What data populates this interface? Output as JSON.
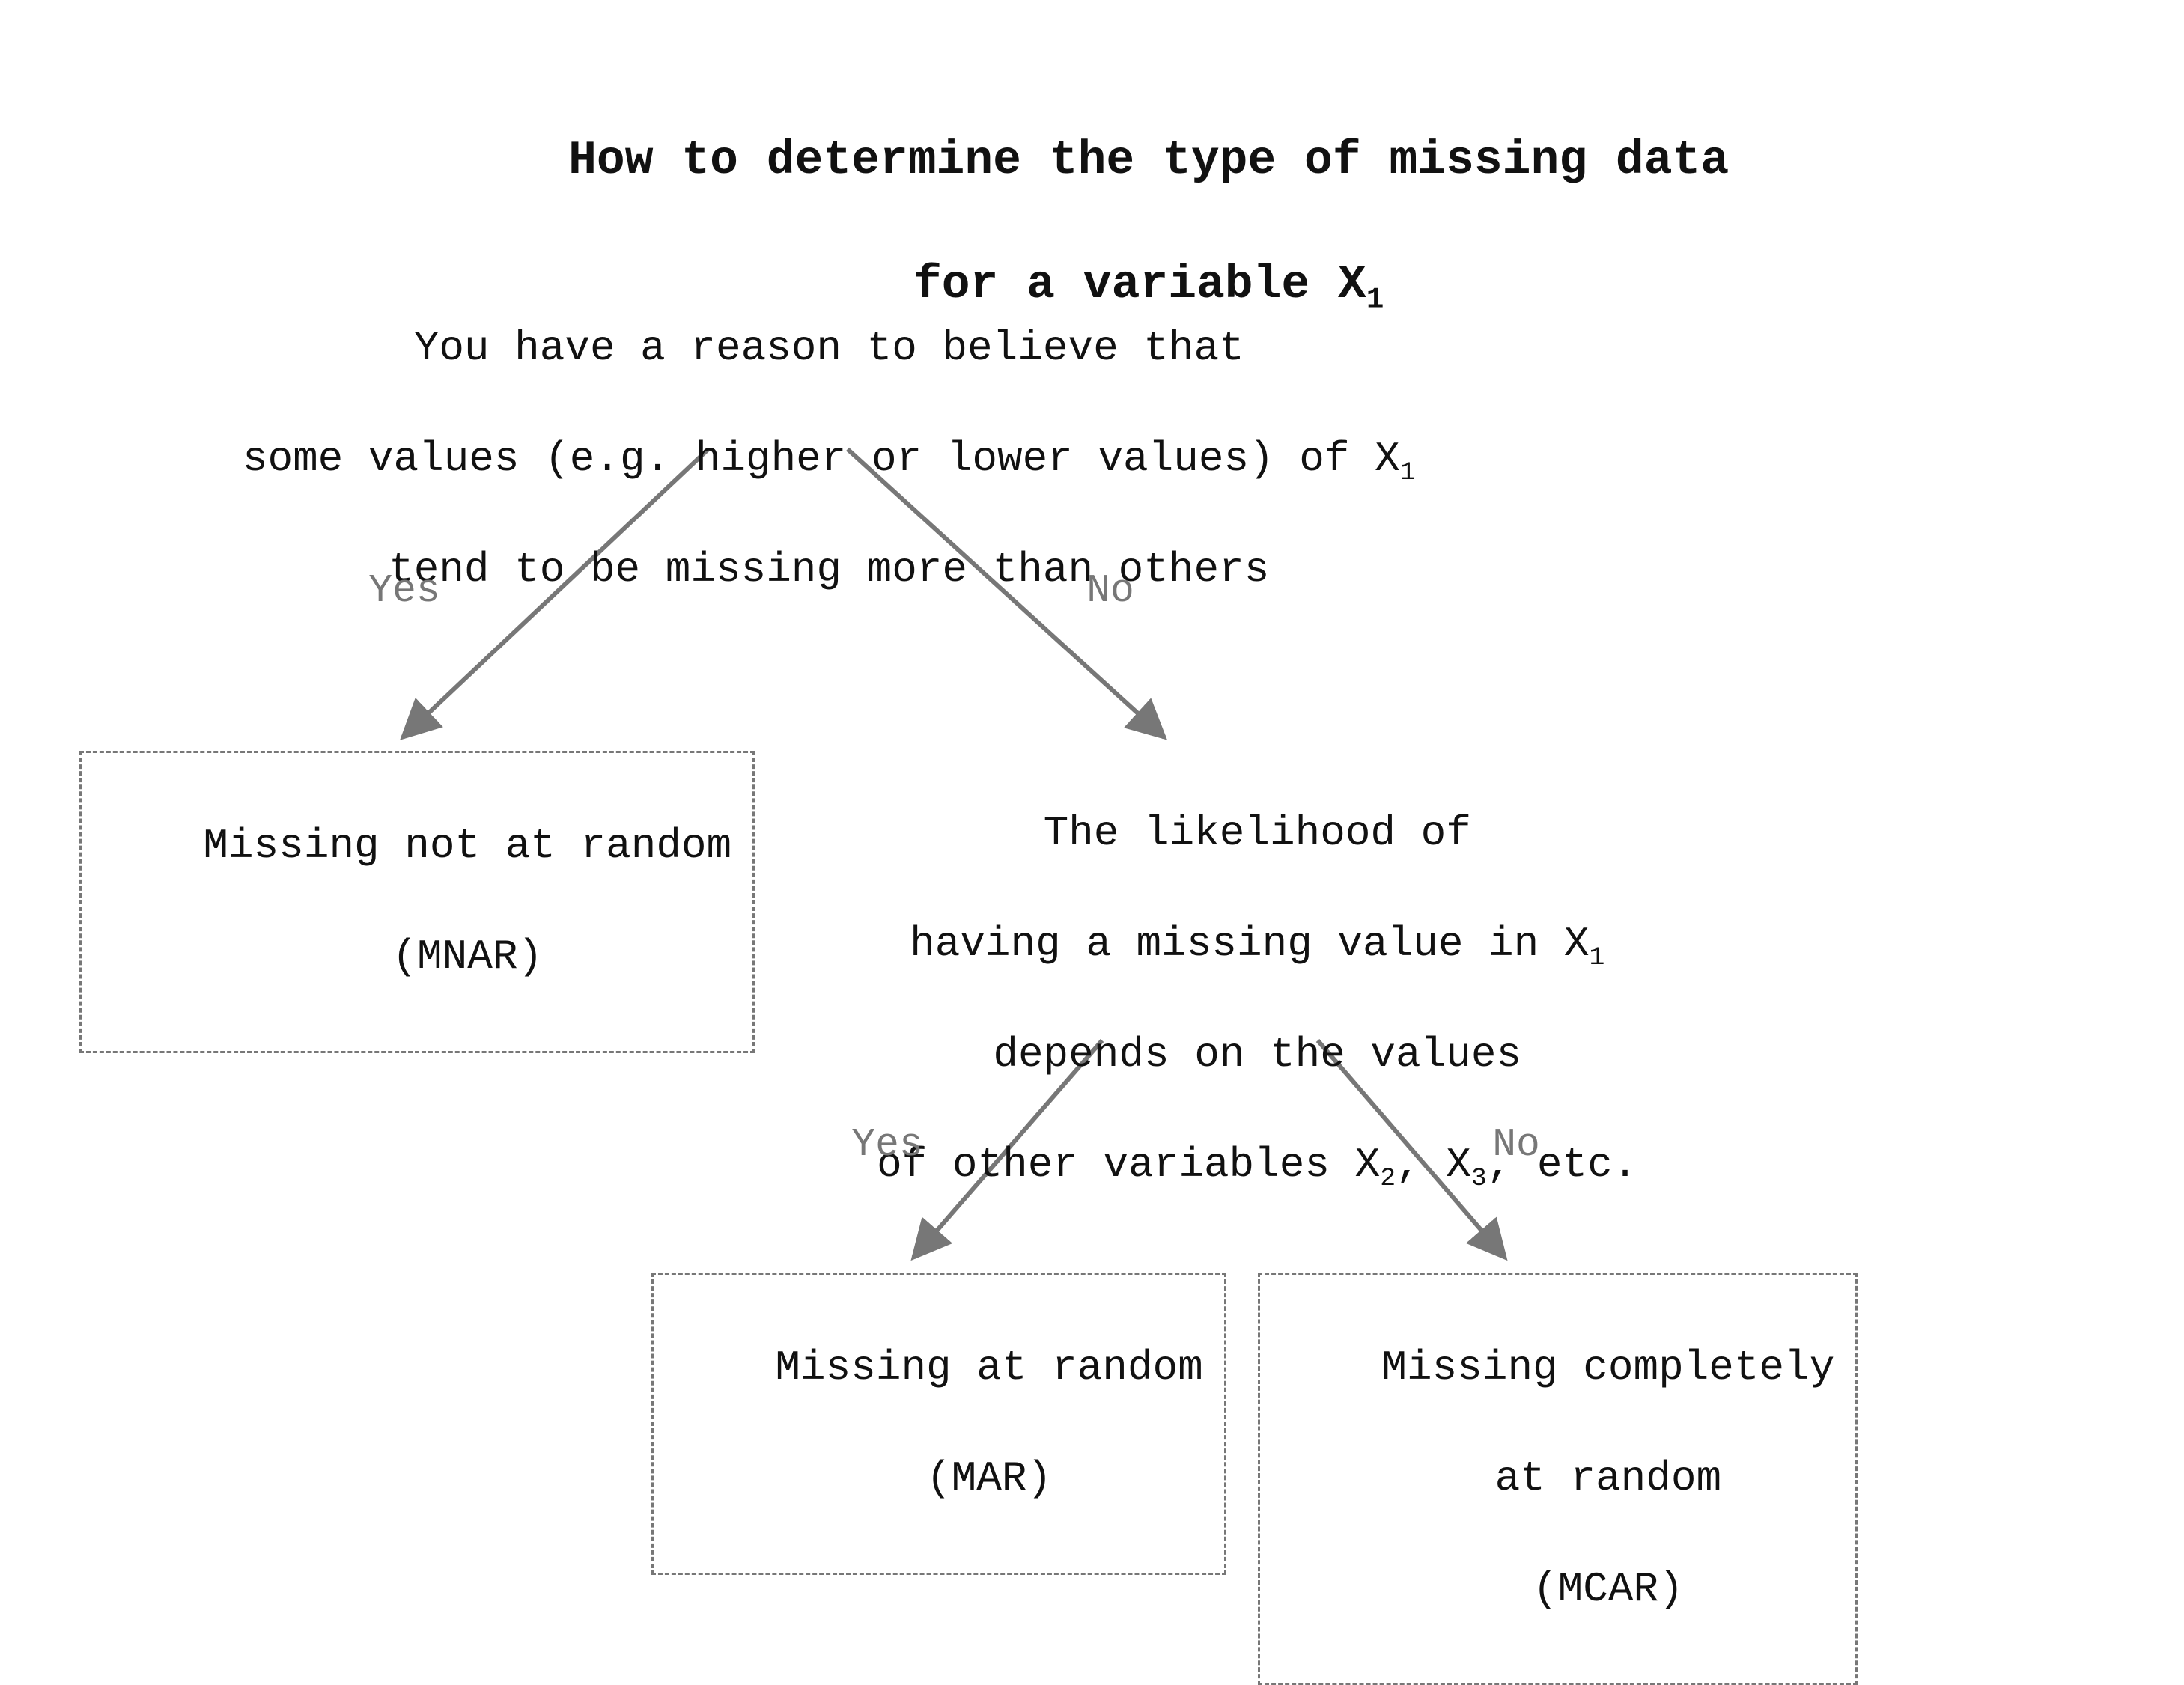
{
  "title": {
    "line1": "How to determine the type of missing data",
    "line2_prefix": "for a variable X",
    "line2_sub": "1"
  },
  "q1": {
    "line1": "You have a reason to believe that",
    "line2_prefix": "some values (e.g. higher or lower values) of X",
    "line2_sub": "1",
    "line3": "tend to be missing more than others"
  },
  "q2": {
    "line1": "The likelihood of",
    "line2_prefix": "having a missing value in X",
    "line2_sub": "1",
    "line3": "depends on the values",
    "line4_prefix": "of other variables X",
    "line4_sub1": "2",
    "line4_mid": ", X",
    "line4_sub2": "3",
    "line4_suffix": ", etc."
  },
  "edges": {
    "q1_yes": "Yes",
    "q1_no": "No",
    "q2_yes": "Yes",
    "q2_no": "No"
  },
  "results": {
    "mnar": {
      "line1": "Missing not at random",
      "line2": "(MNAR)"
    },
    "mar": {
      "line1": "Missing at random",
      "line2": "(MAR)"
    },
    "mcar": {
      "line1": "Missing completely",
      "line2": "at random",
      "line3": "(MCAR)"
    }
  },
  "chart_data": {
    "type": "table",
    "title": "How to determine the type of missing data for a variable X1",
    "description": "Decision tree (flowchart) classifying missing-data mechanism for a variable X1.",
    "nodes": [
      {
        "id": "q1",
        "kind": "decision",
        "text": "You have a reason to believe that some values (e.g. higher or lower values) of X1 tend to be missing more than others"
      },
      {
        "id": "mnar",
        "kind": "terminal",
        "text": "Missing not at random (MNAR)"
      },
      {
        "id": "q2",
        "kind": "decision",
        "text": "The likelihood of having a missing value in X1 depends on the values of other variables X2, X3, etc."
      },
      {
        "id": "mar",
        "kind": "terminal",
        "text": "Missing at random (MAR)"
      },
      {
        "id": "mcar",
        "kind": "terminal",
        "text": "Missing completely at random (MCAR)"
      }
    ],
    "edges": [
      {
        "from": "q1",
        "to": "mnar",
        "label": "Yes"
      },
      {
        "from": "q1",
        "to": "q2",
        "label": "No"
      },
      {
        "from": "q2",
        "to": "mar",
        "label": "Yes"
      },
      {
        "from": "q2",
        "to": "mcar",
        "label": "No"
      }
    ]
  }
}
